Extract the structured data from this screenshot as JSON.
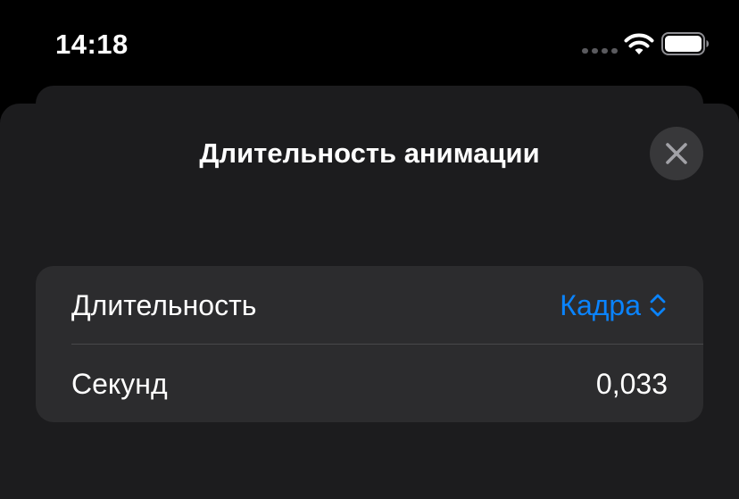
{
  "status_bar": {
    "time": "14:18",
    "signal_icon": "cellular-signal-dots",
    "wifi_icon": "wifi-icon",
    "battery_icon": "battery-full-icon"
  },
  "sheet": {
    "title": "Длительность анимации",
    "close_icon": "close-x-icon"
  },
  "settings": {
    "rows": [
      {
        "label": "Длительность",
        "value": "Кадра",
        "value_icon": "chevron-up-down-icon"
      },
      {
        "label": "Секунд",
        "value": "0,033"
      }
    ]
  },
  "colors": {
    "background": "#000000",
    "sheet": "#1c1c1e",
    "group": "#2c2c2e",
    "accent": "#0a84ff",
    "text": "#ffffff"
  }
}
